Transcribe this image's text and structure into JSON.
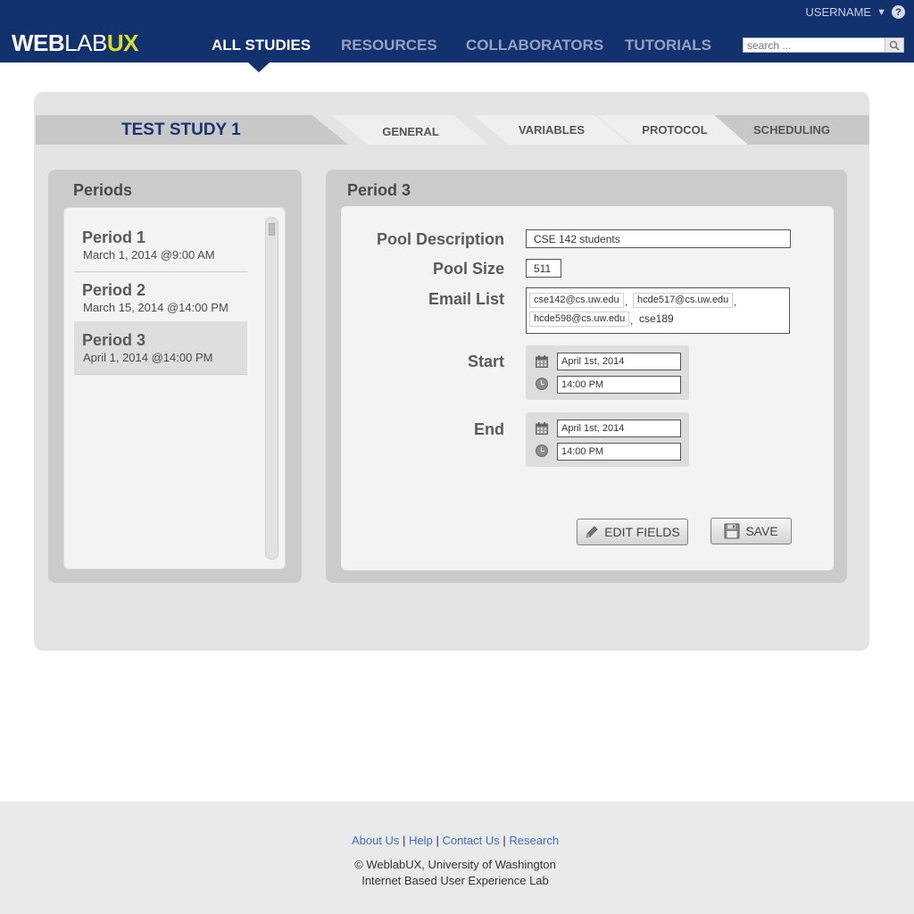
{
  "header": {
    "logo": {
      "part1": "WEB",
      "part2": "LAB",
      "part3": "UX"
    },
    "username": "USERNAME",
    "help_glyph": "?",
    "nav": [
      {
        "label": "ALL STUDIES",
        "active": true
      },
      {
        "label": "RESOURCES",
        "active": false
      },
      {
        "label": "COLLABORATORS",
        "active": false
      },
      {
        "label": "TUTORIALS",
        "active": false
      }
    ],
    "search": {
      "placeholder": "search ..."
    }
  },
  "study": {
    "title": "TEST STUDY 1",
    "tabs": [
      {
        "label": "GENERAL"
      },
      {
        "label": "VARIABLES"
      },
      {
        "label": "PROTOCOL"
      },
      {
        "label": "SCHEDULING"
      }
    ]
  },
  "periods": {
    "heading": "Periods",
    "items": [
      {
        "name": "Period 1",
        "date": "March 1, 2014 @9:00 AM"
      },
      {
        "name": "Period 2",
        "date": "March 15, 2014 @14:00 PM"
      },
      {
        "name": "Period 3",
        "date": "April 1, 2014 @14:00 PM",
        "selected": true
      }
    ]
  },
  "detail": {
    "heading": "Period 3",
    "pool_description": {
      "label": "Pool Description",
      "value": "CSE 142 students"
    },
    "pool_size": {
      "label": "Pool Size",
      "value": "511"
    },
    "email_list": {
      "label": "Email List",
      "chips": [
        "cse142@cs.uw.edu",
        "hcde517@cs.uw.edu",
        "hcde598@cs.uw.edu"
      ],
      "separator": ",",
      "pending": "cse189"
    },
    "start": {
      "label": "Start",
      "date": "April 1st, 2014",
      "time": "14:00 PM"
    },
    "end": {
      "label": "End",
      "date": "April 1st, 2014",
      "time": "14:00 PM"
    },
    "buttons": {
      "edit": "EDIT FIELDS",
      "save": "SAVE"
    }
  },
  "footer": {
    "links": [
      "About Us",
      "Help",
      "Contact Us",
      "Research"
    ],
    "link_separator": "|",
    "copyright": "© WeblabUX, University of Washington",
    "tagline": "Internet Based User Experience Lab"
  },
  "colors": {
    "header_bg": "#12316f",
    "accent_yellow": "#d7df23",
    "study_title": "#1b3470",
    "link": "#3d6fc2"
  }
}
